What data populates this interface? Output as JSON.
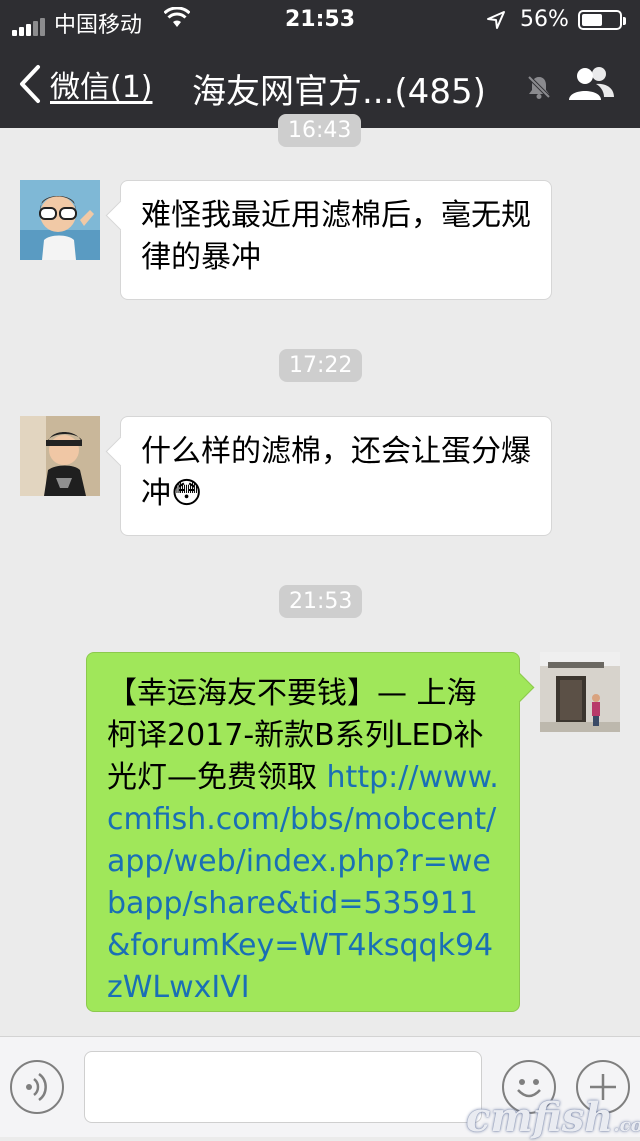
{
  "status_bar": {
    "carrier": "中国移动",
    "time": "21:53",
    "battery_percent_label": "56%",
    "battery_level": 0.56
  },
  "nav": {
    "back_label": "微信(1)",
    "title": "海友网官方...(485)"
  },
  "messages": [
    {
      "type": "timestamp",
      "text": "16:43"
    },
    {
      "type": "incoming",
      "text": "难怪我最近用滤棉后，毫无规律的暴冲",
      "emoji": ""
    },
    {
      "type": "timestamp",
      "text": "17:22"
    },
    {
      "type": "incoming",
      "text": "什么样的滤棉，还会让蛋分爆冲",
      "emoji": "😳"
    },
    {
      "type": "timestamp",
      "text": "21:53"
    },
    {
      "type": "outgoing",
      "text": "【幸运海友不要钱】— 上海柯译2017-新款B系列LED补光灯—免费领取 ",
      "link": "http://www.cmfish.com/bbs/mobcent/app/web/index.php?r=webapp/share&tid=535911&forumKey=WT4ksqqk94zWLwxIVI"
    }
  ],
  "watermark": {
    "main": "cmfish",
    "suffix": ".com"
  },
  "colors": {
    "header": "#2e2e32",
    "chat_bg": "#ebebeb",
    "outgoing_bubble": "#a0e75a",
    "link": "#1a6fb5"
  },
  "icons": [
    "signal-icon",
    "wifi-icon",
    "location-arrow-icon",
    "battery-icon",
    "back-chevron-icon",
    "mute-icon",
    "group-members-icon",
    "voice-icon",
    "emoji-icon",
    "plus-icon"
  ]
}
